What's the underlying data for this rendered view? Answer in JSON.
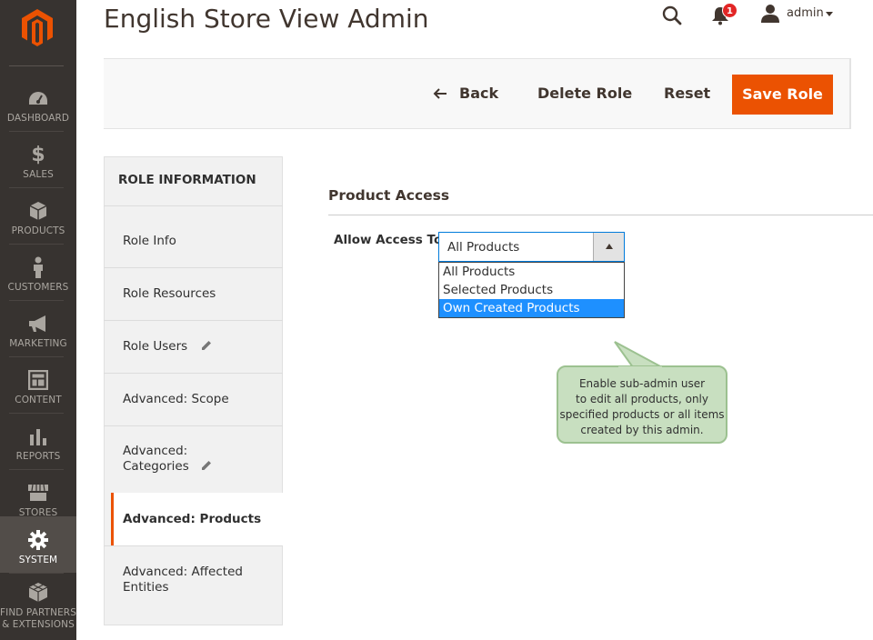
{
  "sidebar": {
    "items": [
      {
        "label": "DASHBOARD",
        "icon": "dashboard-icon"
      },
      {
        "label": "SALES",
        "icon": "dollar-icon"
      },
      {
        "label": "PRODUCTS",
        "icon": "box-icon"
      },
      {
        "label": "CUSTOMERS",
        "icon": "person-icon"
      },
      {
        "label": "MARKETING",
        "icon": "megaphone-icon"
      },
      {
        "label": "CONTENT",
        "icon": "layout-icon"
      },
      {
        "label": "REPORTS",
        "icon": "bar-chart-icon"
      },
      {
        "label": "STORES",
        "icon": "storefront-icon"
      },
      {
        "label": "SYSTEM",
        "icon": "gear-icon",
        "active": true
      },
      {
        "label": "FIND PARTNERS\n& EXTENSIONS",
        "line1": "FIND PARTNERS",
        "line2": "& EXTENSIONS",
        "icon": "cubes-icon"
      }
    ],
    "brand_color": "#eb5202",
    "background": "#373330"
  },
  "header": {
    "title": "English Store View Admin",
    "notification_count": "1",
    "user": "admin"
  },
  "actions": {
    "back": "Back",
    "delete": "Delete Role",
    "reset": "Reset",
    "save": "Save Role",
    "save_color": "#eb5202"
  },
  "tabs": {
    "title": "ROLE INFORMATION",
    "items": [
      {
        "label": "Role Info"
      },
      {
        "label": "Role Resources"
      },
      {
        "label": "Role Users",
        "editable": true
      },
      {
        "label": "Advanced: Scope"
      },
      {
        "label_line1": "Advanced:",
        "label_line2": "Categories",
        "editable": true
      },
      {
        "label": "Advanced: Products",
        "active": true
      },
      {
        "label_line1": "Advanced: Affected",
        "label_line2": "Entities"
      }
    ]
  },
  "main": {
    "section_title": "Product Access",
    "field_label": "Allow Access To",
    "select_value": "All Products",
    "options": [
      "All Products",
      "Selected Products",
      "Own Created Products"
    ],
    "highlighted_option": "Own Created Products"
  },
  "callout": {
    "line1": "Enable sub-admin user",
    "line2": "to edit all products, only",
    "line3": "specified products or all items",
    "line4": "created by this admin."
  }
}
